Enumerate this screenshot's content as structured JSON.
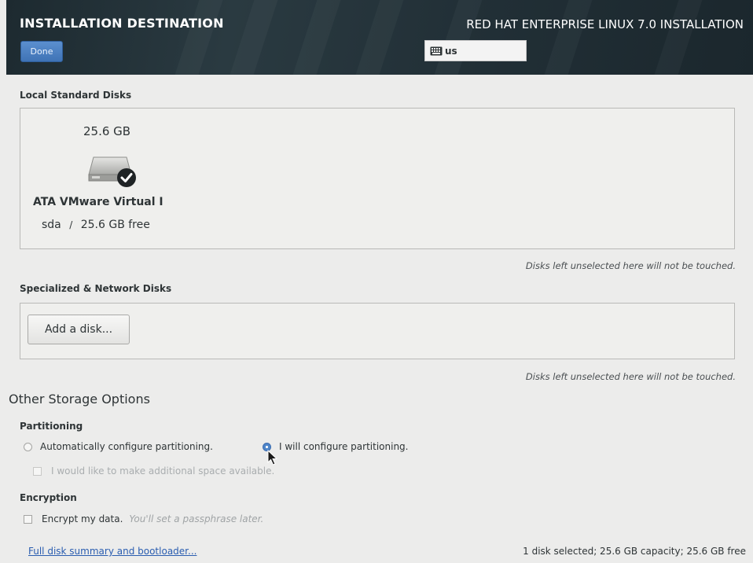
{
  "header": {
    "title": "INSTALLATION DESTINATION",
    "done_label": "Done",
    "product": "RED HAT ENTERPRISE LINUX 7.0 INSTALLATION",
    "keyboard_layout": "us"
  },
  "local_disks": {
    "label": "Local Standard Disks",
    "disks": [
      {
        "size": "25.6 GB",
        "name": "ATA VMware Virtual I",
        "device": "sda",
        "separator": "/",
        "free": "25.6 GB free",
        "selected": true
      }
    ],
    "note": "Disks left unselected here will not be touched."
  },
  "network_disks": {
    "label": "Specialized & Network Disks",
    "add_label": "Add a disk...",
    "note": "Disks left unselected here will not be touched."
  },
  "other": {
    "title": "Other Storage Options",
    "partitioning": {
      "label": "Partitioning",
      "auto_label": "Automatically configure partitioning.",
      "manual_label": "I will configure partitioning.",
      "selected": "manual",
      "space_label": "I would like to make additional space available."
    },
    "encryption": {
      "label": "Encryption",
      "encrypt_label": "Encrypt my data.",
      "hint": "You'll set a passphrase later."
    }
  },
  "footer": {
    "summary_link": "Full disk summary and bootloader...",
    "summary": "1 disk selected; 25.6 GB capacity; 25.6 GB free"
  },
  "icons": {
    "keyboard": "keyboard-icon",
    "disk": "hard-disk-icon",
    "selected": "checkmark-icon",
    "cursor": "mouse-pointer-icon"
  },
  "colors": {
    "header_bg": "#223037",
    "done_button": "#4a7fc1",
    "link": "#2a5db0"
  }
}
